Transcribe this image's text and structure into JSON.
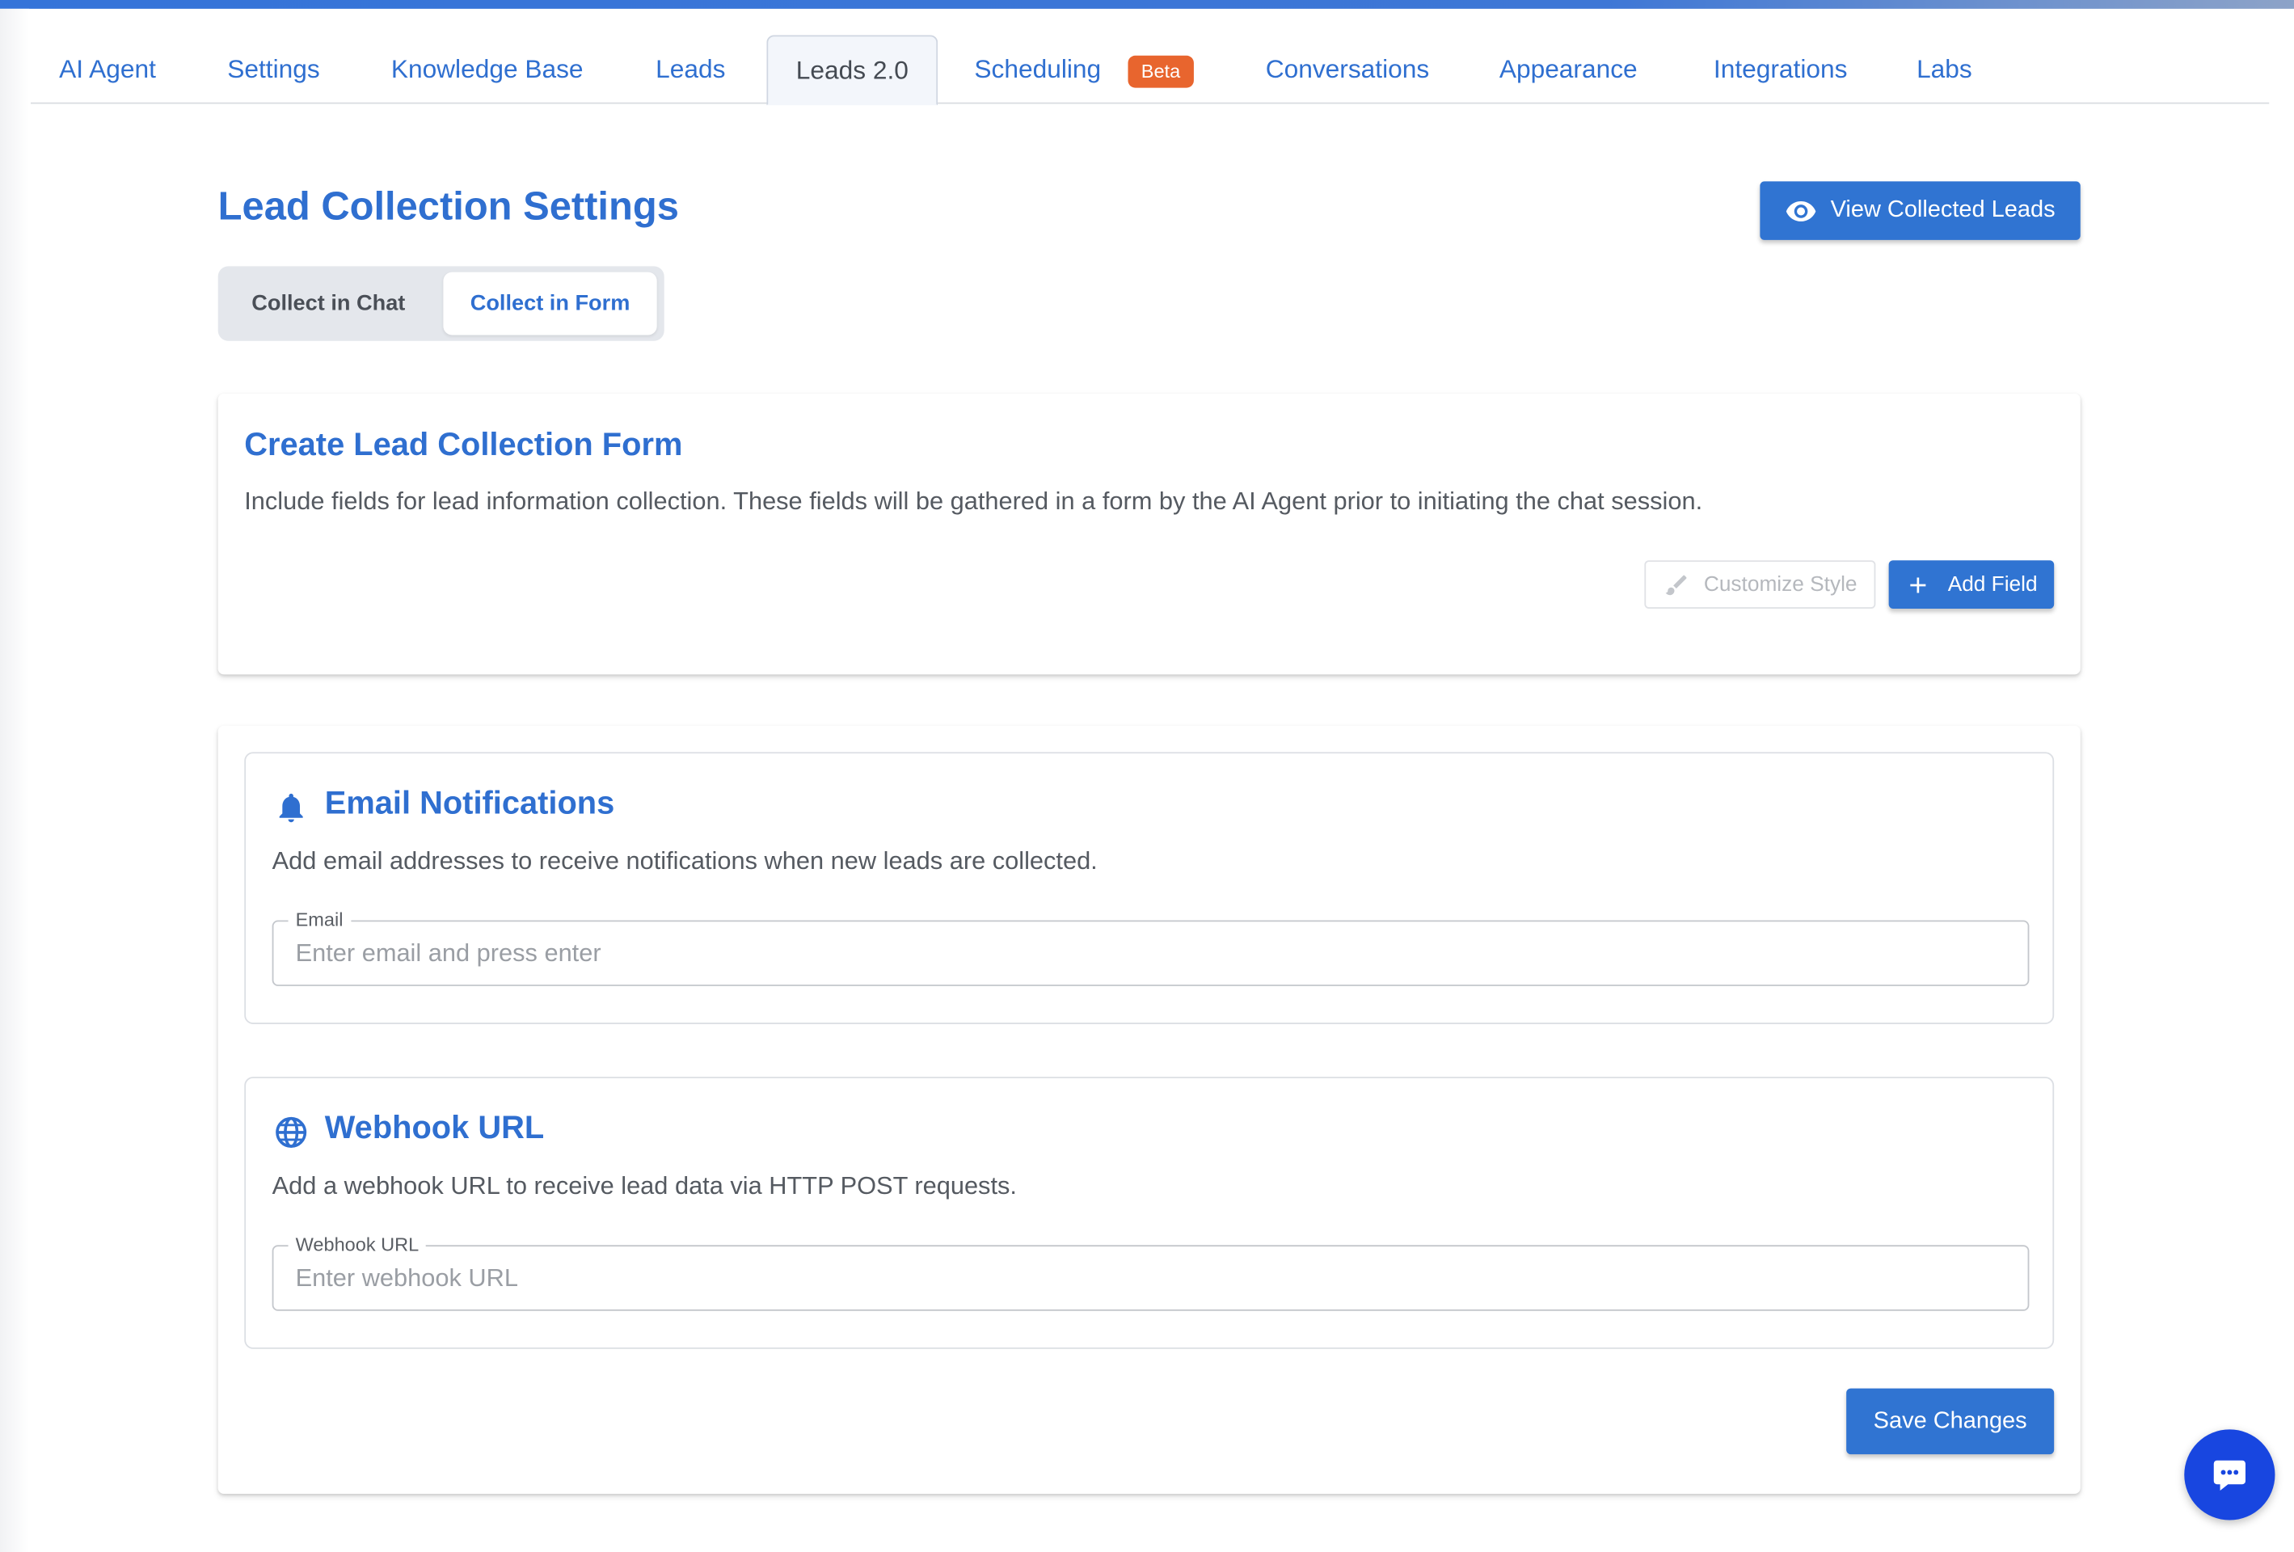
{
  "tabs": [
    {
      "label": "AI Agent"
    },
    {
      "label": "Settings"
    },
    {
      "label": "Knowledge Base"
    },
    {
      "label": "Leads"
    },
    {
      "label": "Leads 2.0"
    },
    {
      "label": "Scheduling",
      "badge": "Beta"
    },
    {
      "label": "Conversations"
    },
    {
      "label": "Appearance"
    },
    {
      "label": "Integrations"
    },
    {
      "label": "Labs"
    }
  ],
  "active_tab": "Leads 2.0",
  "header": {
    "title": "Lead Collection Settings",
    "view_leads_label": "View Collected Leads",
    "view_leads_icon": "eye-icon"
  },
  "mode_toggle": {
    "options": [
      "Collect in Chat",
      "Collect in Form"
    ],
    "selected": "Collect in Form"
  },
  "form_card": {
    "title": "Create Lead Collection Form",
    "description": "Include fields for lead information collection. These fields will be gathered in a form by the AI Agent prior to initiating the chat session.",
    "customize_label": "Customize Style",
    "customize_icon": "brush-icon",
    "customize_disabled": true,
    "add_field_label": "Add Field",
    "add_field_icon": "plus-icon"
  },
  "email_section": {
    "icon": "bell-icon",
    "title": "Email Notifications",
    "description": "Add email addresses to receive notifications when new leads are collected.",
    "field_label": "Email",
    "placeholder": "Enter email and press enter",
    "value": ""
  },
  "webhook_section": {
    "icon": "globe-icon",
    "title": "Webhook URL",
    "description": "Add a webhook URL to receive lead data via HTTP POST requests.",
    "field_label": "Webhook URL",
    "placeholder": "Enter webhook URL",
    "value": ""
  },
  "save_label": "Save Changes",
  "chat_fab_icon": "chat-bubble-icon",
  "colors": {
    "accent": "#2f6fd0",
    "button": "#3074d2",
    "badge": "#e8652e",
    "fab": "#1846e0"
  }
}
